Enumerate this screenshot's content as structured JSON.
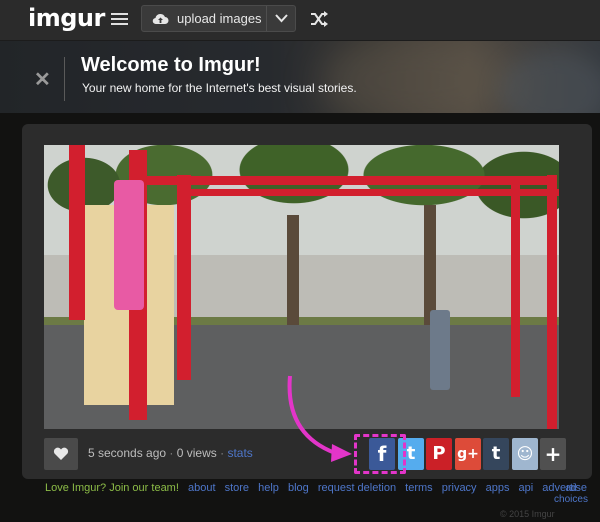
{
  "header": {
    "logo": "imgur",
    "upload_label": "upload images",
    "icons": [
      "menu-icon",
      "cloud-upload-icon",
      "chevron-down-icon",
      "shuffle-icon"
    ]
  },
  "banner": {
    "title": "Welcome to Imgur!",
    "subtitle": "Your new home for the Internet's best visual stories.",
    "close_glyph": "✕"
  },
  "post": {
    "time": "5 seconds ago",
    "separator": "·",
    "views": "0 views",
    "stats": "stats"
  },
  "share": {
    "buttons": [
      {
        "id": "facebook",
        "glyph": "f",
        "color": "#3b5998"
      },
      {
        "id": "twitter",
        "glyph": "t",
        "color": "#55acee"
      },
      {
        "id": "pinterest",
        "glyph": "P",
        "color": "#cb2027"
      },
      {
        "id": "googleplus",
        "glyph": "g+",
        "color": "#dd4b39"
      },
      {
        "id": "tumblr",
        "glyph": "t",
        "color": "#35465c"
      },
      {
        "id": "reddit",
        "glyph": "☺",
        "color": "#9fb6cf"
      },
      {
        "id": "more",
        "glyph": "+",
        "color": "#505050"
      }
    ]
  },
  "footer": {
    "join": "Love Imgur? Join our team!",
    "links": [
      "about",
      "store",
      "help",
      "blog",
      "request deletion",
      "terms",
      "privacy",
      "apps",
      "api",
      "advertise"
    ],
    "ad_choices": "ad choices",
    "copyright": "© 2015 Imgur"
  },
  "colors": {
    "accent_link": "#4e76c9",
    "join_green": "#8cbc47",
    "highlight": "#e335c9"
  }
}
